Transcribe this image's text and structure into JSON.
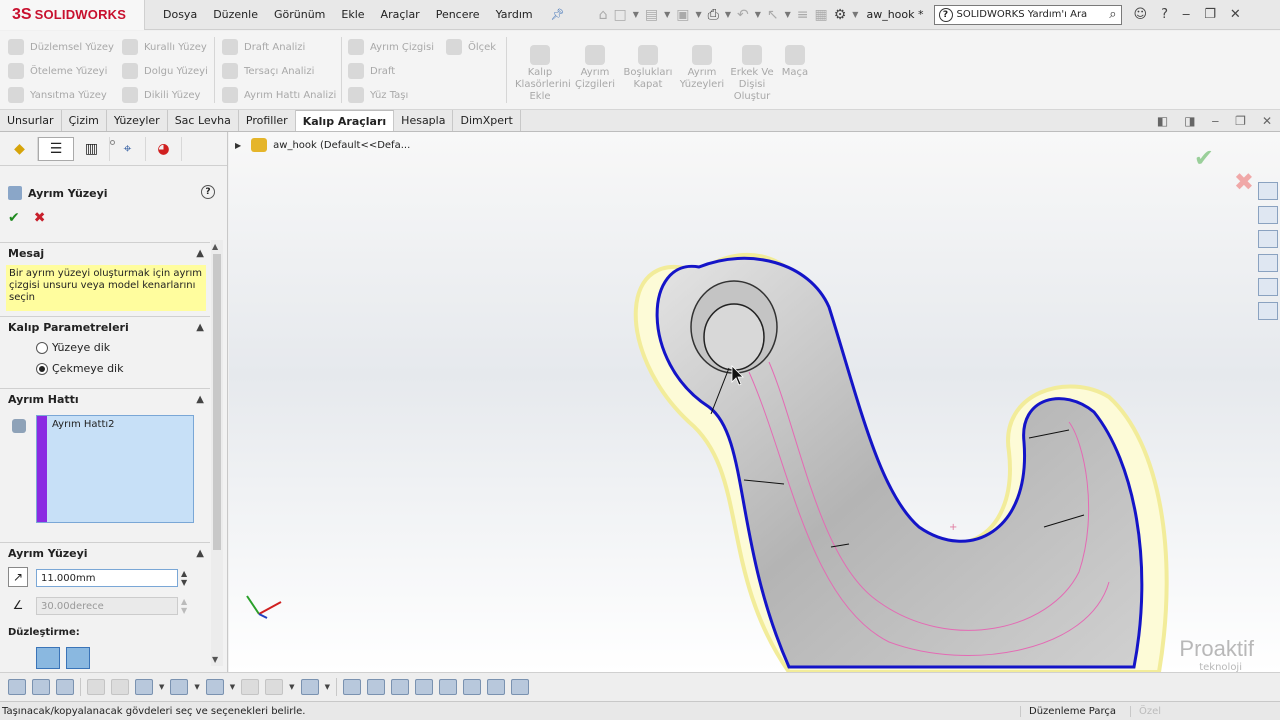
{
  "app": {
    "brand_ds": "3S",
    "brand_name": "SOLIDWORKS",
    "document_title": "aw_hook *"
  },
  "menu": [
    "Dosya",
    "Düzenle",
    "Görünüm",
    "Ekle",
    "Araçlar",
    "Pencere",
    "Yardım"
  ],
  "search": {
    "placeholder": "SOLIDWORKS Yardım'ı Ara"
  },
  "ribbon": {
    "col1": [
      "Düzlemsel Yüzey",
      "Öteleme Yüzeyi",
      "Yansıtma Yüzey"
    ],
    "col2": [
      "Kurallı Yüzey",
      "Dolgu Yüzeyi",
      "Dikili Yüzey"
    ],
    "col3": [
      "Draft Analizi",
      "Tersaçı Analizi",
      "Ayrım Hattı Analizi"
    ],
    "col4": [
      "Ayrım Çizgisi",
      "Draft",
      "Yüz Taşı"
    ],
    "col5": [
      "Ölçek"
    ],
    "big": [
      "Kalıp Klasörlerini Ekle",
      "Ayrım Çizgileri",
      "Boşlukları Kapat",
      "Ayrım Yüzeyleri",
      "Erkek Ve Dişisi Oluştur",
      "Maça"
    ]
  },
  "tabs": [
    "Unsurlar",
    "Çizim",
    "Yüzeyler",
    "Sac Levha",
    "Profiller",
    "Kalıp Araçları",
    "Hesapla",
    "DimXpert"
  ],
  "active_tab": "Kalıp Araçları",
  "property_manager": {
    "title": "Ayrım Yüzeyi",
    "help": "?",
    "message_header": "Mesaj",
    "message_text": "Bir ayrım yüzeyi oluşturmak için ayrım çizgisi unsuru veya model kenarlarını seçin",
    "mold_params_header": "Kalıp Parametreleri",
    "radio_options": [
      "Yüzeye dik",
      "Çekmeye dik"
    ],
    "radio_selected": "Çekmeye dik",
    "parting_line_header": "Ayrım Hattı",
    "parting_line_item": "Ayrım Hattı2",
    "parting_surface_header": "Ayrım Yüzeyi",
    "distance_value": "11.000mm",
    "angle_value": "30.00derece",
    "smoothing_label": "Düzleştirme:"
  },
  "feature_tree": {
    "root": "aw_hook  (Default<<Defa..."
  },
  "watermark": {
    "line1": "Proaktif",
    "line2": "teknoloji"
  },
  "status": {
    "message": "Taşınacak/kopyalanacak gövdeleri seç ve seçenekleri belirle.",
    "mode": "Düzenleme Parça",
    "custom": "Özel"
  }
}
